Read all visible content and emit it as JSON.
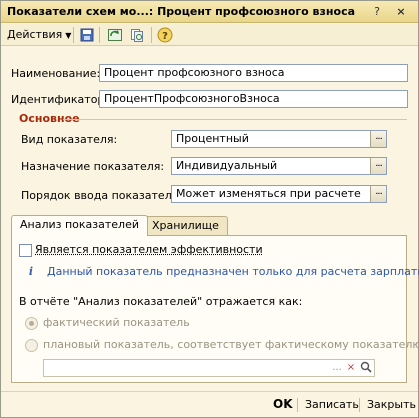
{
  "window": {
    "title": "Показатели схем мо...: Процент профсоюзного взноса",
    "help_label": "?",
    "close_label": "×"
  },
  "toolbar": {
    "actions_label": "Действия",
    "icons": [
      "save-and-close-icon",
      "refresh-icon",
      "copy-icon",
      "help-icon"
    ]
  },
  "form": {
    "name_label": "Наименование:",
    "name_value": "Процент профсоюзного взноса",
    "id_label": "Идентификатор:",
    "id_value": "ПроцентПрофсоюзногоВзноса",
    "group_title": "Основное",
    "kind_label": "Вид показателя:",
    "kind_value": "Процентный",
    "purpose_label": "Назначение показателя:",
    "purpose_value": "Индивидуальный",
    "input_order_label": "Порядок ввода показателя:",
    "input_order_value": "Может изменяться при расчете",
    "select_button": "..."
  },
  "tabs": {
    "analysis": "Анализ показателей",
    "storage": "Хранилище"
  },
  "analysis": {
    "efficiency_label": "Является показателем эффективности",
    "efficiency_checked": false,
    "info_text": "Данный показатель предназначен только для расчета зарплаты",
    "report_label": "В отчёте \"Анализ показателей\" отражается как:",
    "radio_actual": "фактический показатель",
    "radio_planned": "плановый показатель, соответствует фактическому показателю:",
    "field_value": "",
    "field_buttons": [
      "...",
      "×",
      "🔍"
    ]
  },
  "bottom": {
    "ok": "OK",
    "save": "Записать",
    "close": "Закрыть"
  },
  "colors": {
    "window_bg": "#fbf4e1",
    "group_title": "#a62a0a",
    "info_text": "#2c55a8"
  }
}
